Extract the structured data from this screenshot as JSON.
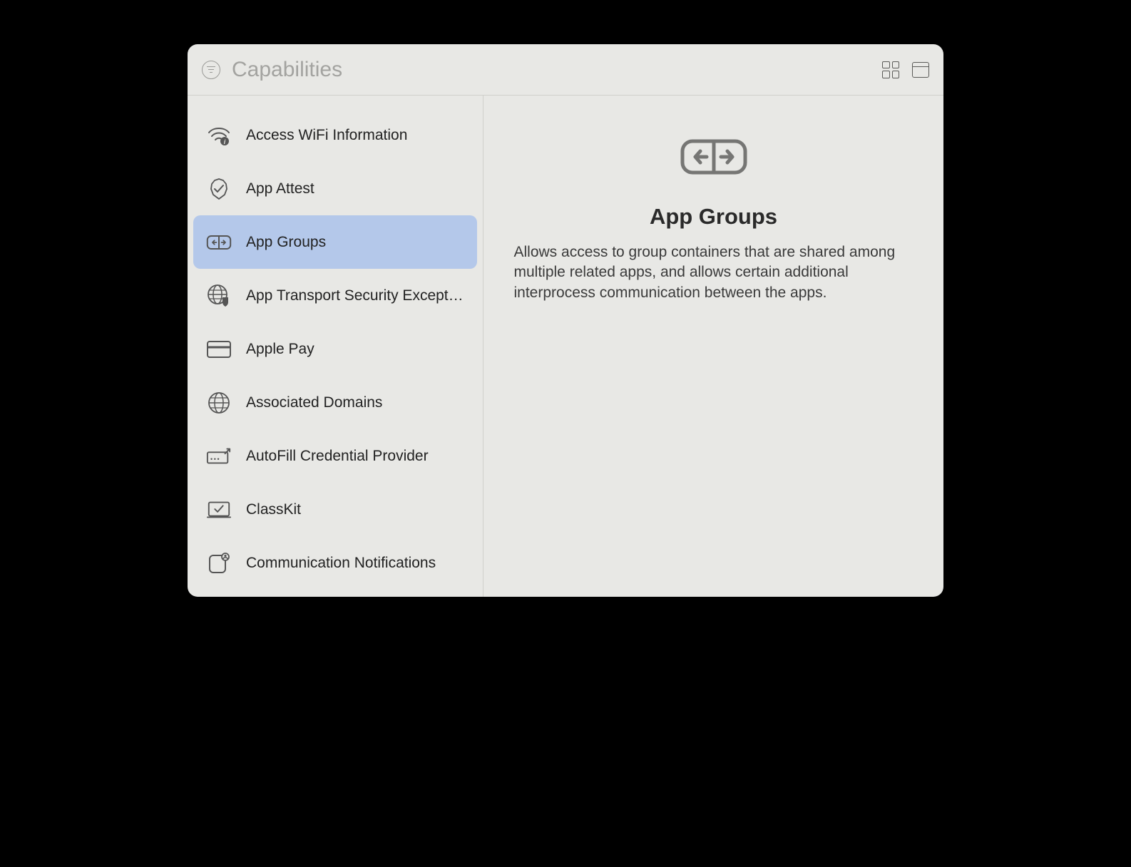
{
  "header": {
    "title": "Capabilities"
  },
  "sidebar": {
    "items": [
      {
        "label": "Access WiFi Information",
        "icon": "wifi-info-icon",
        "selected": false
      },
      {
        "label": "App Attest",
        "icon": "attest-icon",
        "selected": false
      },
      {
        "label": "App Groups",
        "icon": "link-icon",
        "selected": true
      },
      {
        "label": "App Transport Security Excepti…",
        "icon": "globe-shield-icon",
        "selected": false
      },
      {
        "label": "Apple Pay",
        "icon": "card-icon",
        "selected": false
      },
      {
        "label": "Associated Domains",
        "icon": "globe-icon",
        "selected": false
      },
      {
        "label": "AutoFill Credential Provider",
        "icon": "key-form-icon",
        "selected": false
      },
      {
        "label": "ClassKit",
        "icon": "classkit-icon",
        "selected": false
      },
      {
        "label": "Communication Notifications",
        "icon": "comm-notif-icon",
        "selected": false
      }
    ]
  },
  "detail": {
    "title": "App Groups",
    "description": "Allows access to group containers that are shared among multiple related apps, and allows certain additional interprocess communication between the apps."
  }
}
